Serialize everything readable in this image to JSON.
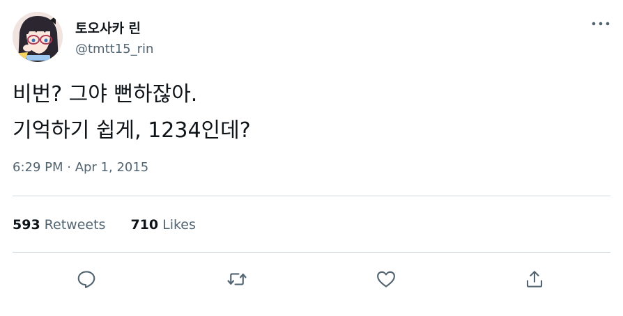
{
  "user": {
    "display_name": "토오사카 린",
    "handle": "@tmtt15_rin",
    "avatar_icon": "avatar-anime-girl-icon"
  },
  "tweet": {
    "lines": [
      "비번? 그야 뻔하잖아.",
      "기억하기 쉽게, 1234인데?"
    ],
    "timestamp": "6:29 PM · Apr 1, 2015"
  },
  "stats": {
    "retweets_count": "593",
    "retweets_label": "Retweets",
    "likes_count": "710",
    "likes_label": "Likes"
  },
  "actions": [
    {
      "name": "reply",
      "icon": "speech-bubble-icon"
    },
    {
      "name": "retweet",
      "icon": "retweet-arrows-icon"
    },
    {
      "name": "like",
      "icon": "heart-icon"
    },
    {
      "name": "share",
      "icon": "share-upload-icon"
    }
  ],
  "colors": {
    "text_primary": "#0f1419",
    "text_secondary": "#536471",
    "divider": "#cfd9de"
  }
}
